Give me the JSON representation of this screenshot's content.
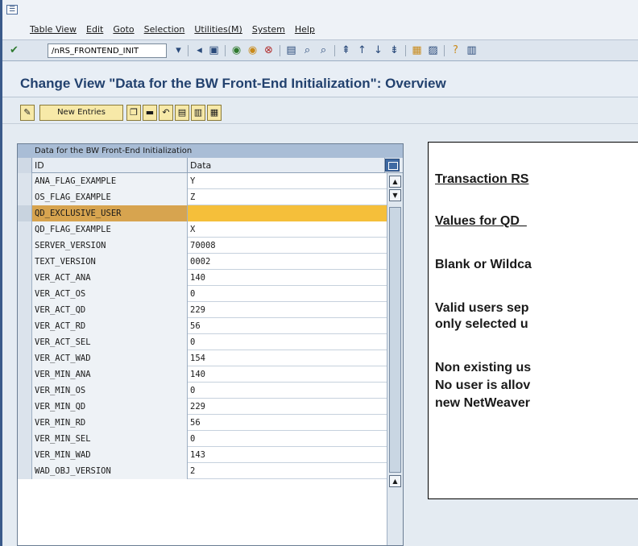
{
  "menu": {
    "items": [
      "Table View",
      "Edit",
      "Goto",
      "Selection",
      "Utilities(M)",
      "System",
      "Help"
    ]
  },
  "toolbar": {
    "command_value": "/nRS_FRONTEND_INIT",
    "icons": [
      "enter-icon",
      "save-icon",
      "back-icon",
      "exit-icon",
      "cancel-icon",
      "print-icon",
      "find-icon",
      "find-next-icon",
      "first-page-icon",
      "previous-page-icon",
      "next-page-icon",
      "last-page-icon",
      "create-session-icon",
      "shortcut-icon",
      "help-icon",
      "layout-icon"
    ]
  },
  "title": {
    "text": "Change View \"Data for the BW Front-End Initialization\": Overview"
  },
  "app_toolbar": {
    "new_entries_label": "New Entries"
  },
  "table": {
    "caption": "Data for the BW Front-End Initialization",
    "headers": {
      "id": "ID",
      "data": "Data"
    },
    "highlight_color": "#f5bf3a",
    "rows": [
      {
        "id": "ANA_FLAG_EXAMPLE",
        "data": "Y"
      },
      {
        "id": "OS_FLAG_EXAMPLE",
        "data": "Z"
      },
      {
        "id": "QD_EXCLUSIVE_USER",
        "data": ""
      },
      {
        "id": "QD_FLAG_EXAMPLE",
        "data": "X"
      },
      {
        "id": "SERVER_VERSION",
        "data": "70008"
      },
      {
        "id": "TEXT_VERSION",
        "data": "0002"
      },
      {
        "id": "VER_ACT_ANA",
        "data": "140"
      },
      {
        "id": "VER_ACT_OS",
        "data": "0"
      },
      {
        "id": "VER_ACT_QD",
        "data": "229"
      },
      {
        "id": "VER_ACT_RD",
        "data": "56"
      },
      {
        "id": "VER_ACT_SEL",
        "data": "0"
      },
      {
        "id": "VER_ACT_WAD",
        "data": "154"
      },
      {
        "id": "VER_MIN_ANA",
        "data": "140"
      },
      {
        "id": "VER_MIN_OS",
        "data": "0"
      },
      {
        "id": "VER_MIN_QD",
        "data": "229"
      },
      {
        "id": "VER_MIN_RD",
        "data": "56"
      },
      {
        "id": "VER_MIN_SEL",
        "data": "0"
      },
      {
        "id": "VER_MIN_WAD",
        "data": "143"
      },
      {
        "id": "WAD_OBJ_VERSION",
        "data": "2"
      }
    ]
  },
  "notes": {
    "line1": "Transaction RS",
    "line2": "Values for QD_",
    "line3": "Blank or Wildca",
    "line4": "Valid users sep",
    "line5": "only selected u",
    "line6": "Non existing us",
    "line7": "No user is allov",
    "line8": "new NetWeaver"
  }
}
